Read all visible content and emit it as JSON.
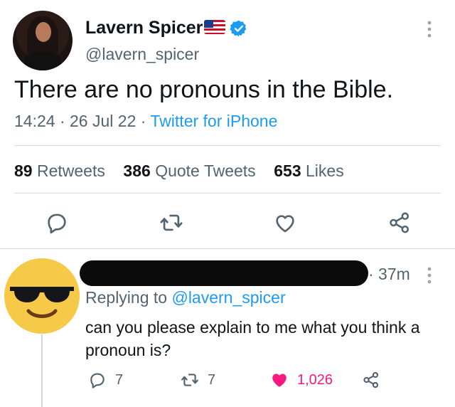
{
  "tweet": {
    "author_name": "Lavern Spicer",
    "author_handle": "@lavern_spicer",
    "text": "There are no pronouns in the Bible.",
    "time": "14:24",
    "date": "26 Jul 22",
    "separator": "·",
    "source": "Twitter for iPhone",
    "retweets_count": "89",
    "retweets_label": "Retweets",
    "quote_count": "386",
    "quote_label": "Quote Tweets",
    "likes_count": "653",
    "likes_label": "Likes"
  },
  "reply": {
    "time": "· 37m",
    "replying_prefix": "Replying to",
    "replying_handle": "@lavern_spicer",
    "text": "can you please explain to me what you think a pronoun is?",
    "reply_count": "7",
    "retweet_count": "7",
    "like_count": "1,026"
  },
  "colors": {
    "accent": "#1d9bf0",
    "like": "#f91880",
    "muted": "#536471",
    "emoji": "#f7c948"
  }
}
